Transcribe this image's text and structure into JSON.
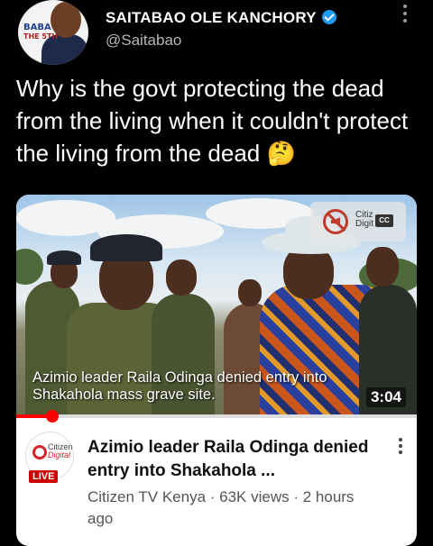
{
  "author": {
    "name": "SAITABAO OLE KANCHORY",
    "handle": "@Saitabao",
    "avatar_badge_line1": "BABA",
    "avatar_badge_line2": "THE 5TH"
  },
  "tweet": {
    "text": "Why is the govt protecting the dead from the living when it couldn't protect the living from the dead 🤔"
  },
  "video_card": {
    "caption_line1": "Azimio leader Raila Odinga denied entry into",
    "caption_line2": "Shakahola mass grave site.",
    "duration": "3:04",
    "watermark_line1": "Citiz",
    "watermark_line2": "Digit",
    "cc_label": "CC",
    "progress_fraction": 0.09,
    "title": "Azimio leader Raila Odinga denied entry into Shakahola ...",
    "channel": "Citizen TV Kenya",
    "views": "63K views",
    "age": "2 hours ago",
    "meta_separator": " · ",
    "channel_logo_line1": "Citizen",
    "channel_logo_line2": "Digital",
    "live_label": "LIVE"
  },
  "icons": {
    "verified": "verified-badge-icon",
    "more_top": "more-vertical-icon",
    "mute": "muted-speaker-icon",
    "captions": "closed-captions-icon",
    "more_card": "more-vertical-icon"
  },
  "colors": {
    "background": "#000000",
    "verified": "#1d9bf0",
    "progress": "#ff0000",
    "live": "#cc0000"
  }
}
